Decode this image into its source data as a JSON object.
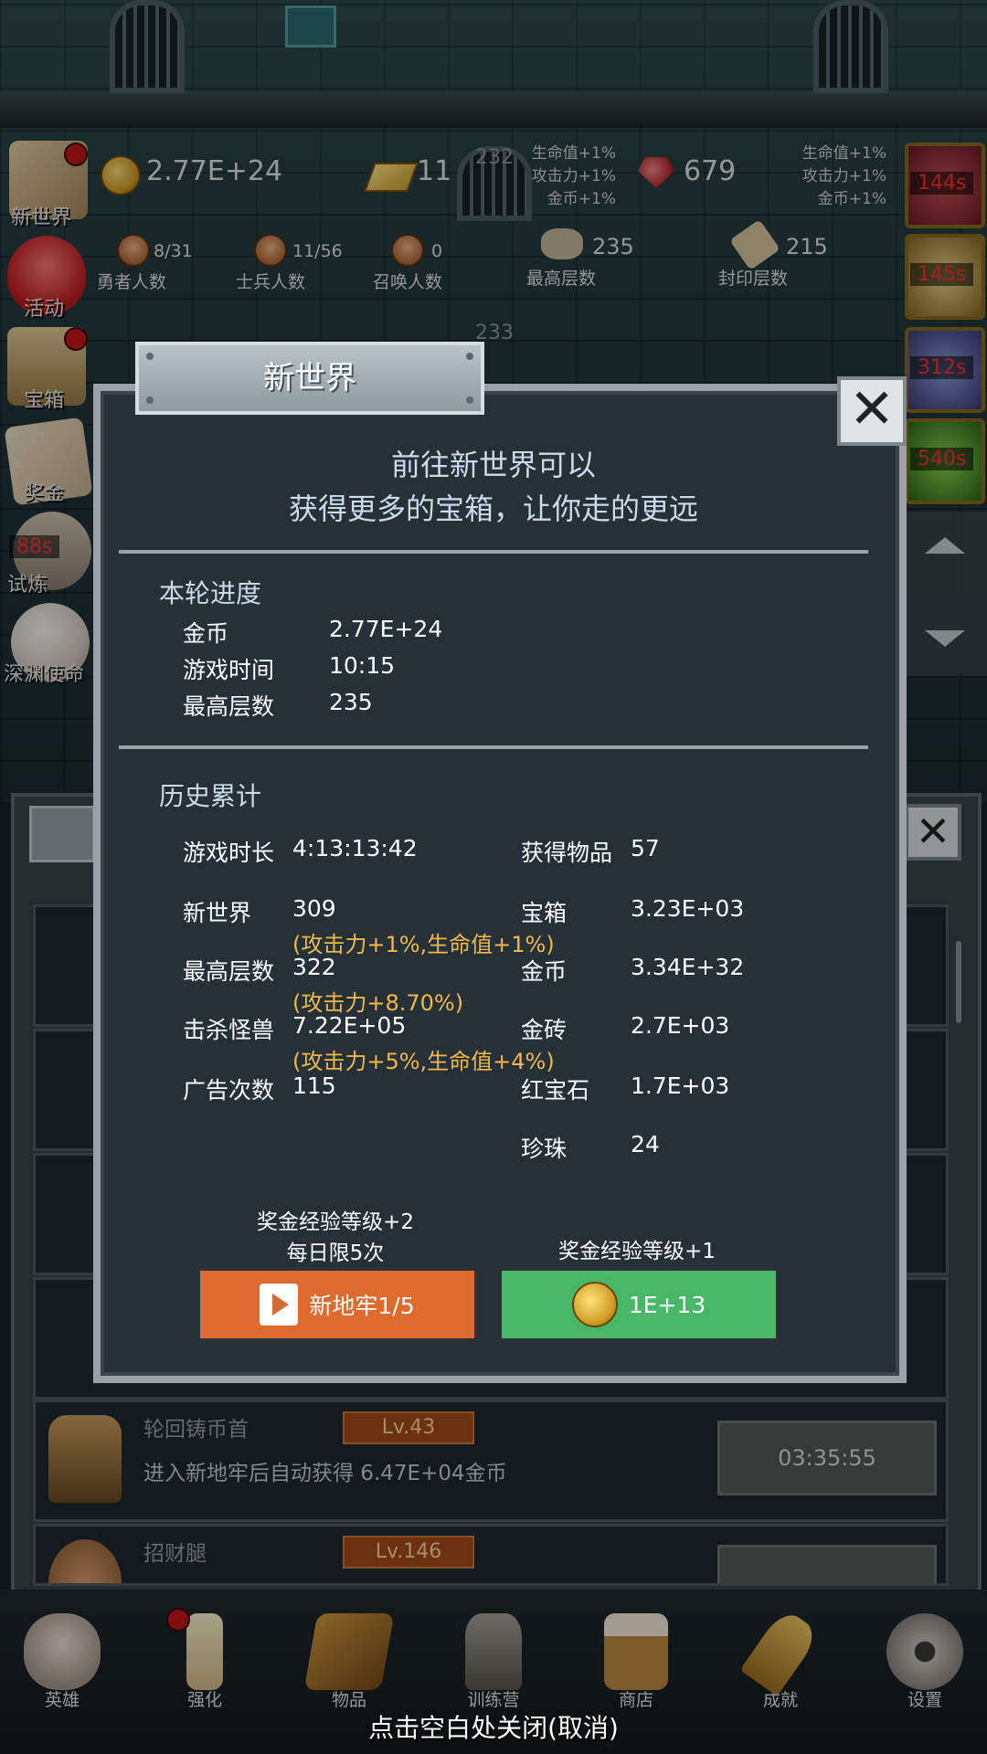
{
  "hud": {
    "gold": "2.77E+24",
    "gold_bars": "11",
    "level_top": "232",
    "level_mid": "233",
    "rubies": "679",
    "bonus_left": [
      "生命值+1%",
      "攻击力+1%",
      "金币+1%"
    ],
    "bonus_right": [
      "生命值+1%",
      "攻击力+1%",
      "金币+1%"
    ],
    "counts": [
      {
        "value": "8/31",
        "label": "勇者人数"
      },
      {
        "value": "11/56",
        "label": "士兵人数"
      },
      {
        "value": "0",
        "label": "召唤人数"
      },
      {
        "value": "235",
        "label": "最高层数"
      },
      {
        "value": "215",
        "label": "封印层数"
      }
    ]
  },
  "left_menu": [
    "新世界",
    "活动",
    "宝箱",
    "奖金",
    "试炼",
    "深渊使命"
  ],
  "left_timer": "88s",
  "right_timers": [
    "144s",
    "145s",
    "312s",
    "540s"
  ],
  "modal": {
    "title": "新世界",
    "close": "✕",
    "intro_line1": "前往新世界可以",
    "intro_line2": "获得更多的宝箱，让你走的更远",
    "current": {
      "heading": "本轮进度",
      "rows": [
        {
          "label": "金币",
          "value": "2.77E+24"
        },
        {
          "label": "游戏时间",
          "value": "10:15"
        },
        {
          "label": "最高层数",
          "value": "235"
        }
      ]
    },
    "history": {
      "heading": "历史累计",
      "left": [
        {
          "label": "游戏时长",
          "value": "4:13:13:42",
          "bonus": ""
        },
        {
          "label": "新世界",
          "value": "309",
          "bonus": "(攻击力+1%,生命值+1%)"
        },
        {
          "label": "最高层数",
          "value": "322",
          "bonus": "(攻击力+8.70%)"
        },
        {
          "label": "击杀怪兽",
          "value": "7.22E+05",
          "bonus": "(攻击力+5%,生命值+4%)"
        },
        {
          "label": "广告次数",
          "value": "115",
          "bonus": ""
        }
      ],
      "right": [
        {
          "label": "获得物品",
          "value": "57"
        },
        {
          "label": "宝箱",
          "value": "3.23E+03"
        },
        {
          "label": "金币",
          "value": "3.34E+32"
        },
        {
          "label": "金砖",
          "value": "2.7E+03"
        },
        {
          "label": "红宝石",
          "value": "1.7E+03"
        },
        {
          "label": "珍珠",
          "value": "24"
        }
      ]
    },
    "left_caption_1": "奖金经验等级+2",
    "left_caption_2": "每日限5次",
    "right_caption": "奖金经验等级+1",
    "btn_ad": "新地牢1/5",
    "btn_coin": "1E+13",
    "colors": {
      "ad_button": "#de6a2e",
      "coin_button": "#48b868"
    }
  },
  "list": {
    "rows": [
      {
        "name": "轮回铸币首",
        "level": "Lv.43",
        "desc": "进入新地牢后自动获得 6.47E+04金币",
        "timer": "03:35:55"
      },
      {
        "name": "招财腿",
        "level": "Lv.146",
        "desc": "",
        "timer": ""
      }
    ]
  },
  "nav": [
    "英雄",
    "强化",
    "物品",
    "训练营",
    "商店",
    "成就",
    "设置"
  ],
  "hint": "点击空白处关闭(取消)"
}
